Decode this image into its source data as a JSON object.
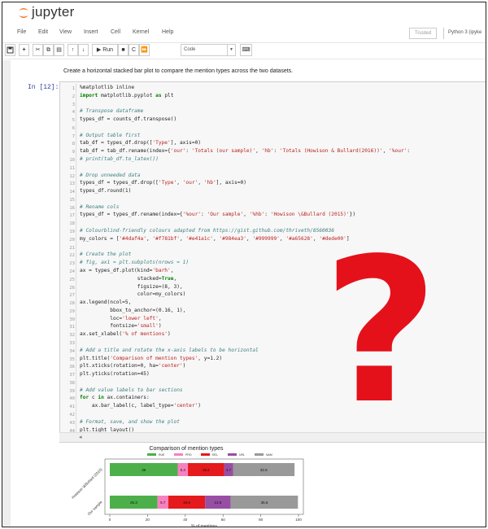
{
  "app": {
    "logo_text": "jupyter"
  },
  "menubar": {
    "items": [
      "File",
      "Edit",
      "View",
      "Insert",
      "Cell",
      "Kernel",
      "Help"
    ],
    "trusted": "Trusted",
    "kernel": "Python 3 (ipyke"
  },
  "toolbar": {
    "run_label": "▶ Run",
    "cell_type": "Code"
  },
  "markdown_text": "Create a horizontal stacked bar plot to compare the mention types across the two datasets.",
  "prompt": "In [12]:",
  "code_lines": [
    "%matplotlib inline",
    "import matplotlib.pyplot as plt",
    "",
    "# Transpose dataframe",
    "types_df = counts_df.transpose()",
    "",
    "# Output table first",
    "tab_df = types_df.drop(['Type'], axis=0)",
    "tab_df = tab_df.rename(index={'our': 'Totals (our sample)', 'hb': 'Totals (Howison & Bullard(2016))', '%our':",
    "# print(tab_df.to_latex())",
    "",
    "# Drop unneeded data",
    "types_df = types_df.drop(['Type', 'our', 'hb'], axis=0)",
    "types_df.round(1)",
    "",
    "# Rename cols",
    "types_df = types_df.rename(index={'%our': 'Our sample', '%hb': 'Howison \\&Bullard (2015)'})",
    "",
    "# Colourblind-friendly colours adapted from https://gist.github.com/thriveth/8560036",
    "my_colors = ['#4daf4a', '#f781bf', '#e41a1c', '#984ea3', '#999999', '#a65628', '#dede00']",
    "",
    "# Create the plot",
    "# fig, ax1 = plt.subplots(nrows = 1)",
    "ax = types_df.plot(kind='barh',",
    "                   stacked=True,",
    "                   figsize=(8, 3),",
    "                   color=my_colors)",
    "ax.legend(ncol=5,",
    "          bbox_to_anchor=(0.16, 1),",
    "          loc='lower left',",
    "          fontsize='small')",
    "ax.set_xlabel('% of mentions')",
    "",
    "# Add a title and rotate the x-axis labels to be horizontal",
    "plt.title('Comparison of mention types', y=1.2)",
    "plt.xticks(rotation=0, ha='center')",
    "plt.yticks(rotation=45)",
    "",
    "# Add value labels to bar sections",
    "for c in ax.containers:",
    "    ax.bar_label(c, label_type='center')",
    "",
    "# Format, save, and show the plot",
    "plt.tight_layout()",
    "plt.savefig('mention-type-comparison.pgf')",
    "plt.show()"
  ],
  "question_mark": "?",
  "colors": {
    "prompt": "#303f9f",
    "comment": "#408080",
    "keyword": "#008000",
    "string": "#ba2121",
    "qmark": "#e4111b"
  },
  "chart_data": {
    "type": "bar",
    "orientation": "horizontal",
    "stacked": true,
    "title": "Comparison of mention types",
    "xlabel": "% of mentions",
    "ylabel": "",
    "categories": [
      "Howison \\&Bullard (2015)",
      "Our sample"
    ],
    "xlim": [
      0,
      100
    ],
    "x_ticks": [
      "0",
      "20",
      "40",
      "60",
      "80",
      "100"
    ],
    "legend_position": "top",
    "series": [
      {
        "name": "RUE",
        "color": "#4daf4a",
        "values": [
          36,
          25.3
        ]
      },
      {
        "name": "PRO",
        "color": "#f781bf",
        "values": [
          5.4,
          5.7
        ]
      },
      {
        "name": "REL",
        "color": "#e41a1c",
        "values": [
          19.2,
          19.5
        ]
      },
      {
        "name": "URL",
        "color": "#984ea3",
        "values": [
          4.7,
          13.6
        ]
      },
      {
        "name": "NAM",
        "color": "#999999",
        "values": [
          32.6,
          35.6
        ]
      }
    ],
    "value_labels": [
      [
        "36",
        "5.4",
        "19.2",
        "4.7",
        "32.6"
      ],
      [
        "25.3",
        "5.7",
        "19.5",
        "13.6",
        "35.6"
      ]
    ]
  }
}
